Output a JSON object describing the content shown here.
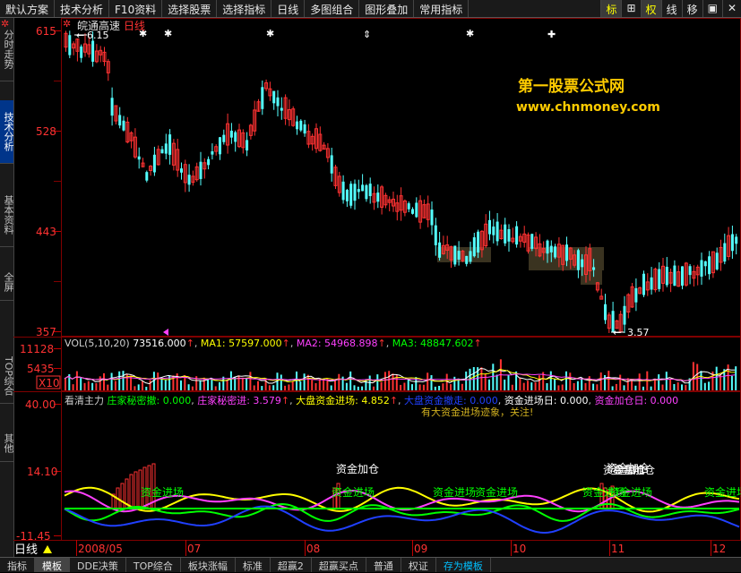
{
  "toolbar": {
    "items": [
      "默认方案",
      "技术分析",
      "F10资料",
      "选择股票",
      "选择指标",
      "日线",
      "多图组合",
      "图形叠加",
      "常用指标"
    ],
    "right_items": [
      "标",
      "权",
      "线",
      "移"
    ]
  },
  "leftnav": {
    "tabs": [
      "分时走势",
      "技术分析",
      "基本资料",
      "全屏",
      "TOP综合",
      "其他"
    ],
    "active": "技术分析"
  },
  "stock": {
    "name": "皖通高速",
    "period": "日线",
    "high_label": "6.15",
    "low_label": "3.57"
  },
  "watermark": {
    "line1": "第一股票公式网",
    "line2": "www.chnmoney.com"
  },
  "price_axis": [
    "615",
    "528",
    "443",
    "357"
  ],
  "volume": {
    "title": "VOL(5,10,20)",
    "value": "73516.000",
    "ma1": "MA1: 57597.000",
    "ma2": "MA2: 54968.898",
    "ma3": "MA3: 48847.602",
    "axis": [
      "11128",
      "5435",
      "X10"
    ]
  },
  "indicator": {
    "name": "看清主力",
    "items": [
      {
        "label": "庄家秘密撤: 0.000",
        "color": "#00ff00"
      },
      {
        "label": "庄家秘密进: 3.579",
        "color": "#ff40ff"
      },
      {
        "label": "大盘资金进场: 4.852",
        "color": "#ffff00"
      },
      {
        "label": "大盘资金撤走: 0.000",
        "color": "#0000ff"
      },
      {
        "label": "资金进场日: 0.000",
        "color": "#ffffff"
      },
      {
        "label": "资金加仓日: 0.000",
        "color": "#ff40ff"
      }
    ],
    "note": "有大资金进场迹象，关注!",
    "axis": [
      "40.00",
      "14.10",
      "-11.45"
    ],
    "annotations": [
      "资金进场",
      "资金加仓"
    ]
  },
  "time_axis": {
    "period": "日线",
    "labels": [
      "2008/05",
      "07",
      "08",
      "09",
      "10",
      "11",
      "12"
    ]
  },
  "bottom_tabs": {
    "items": [
      "指标",
      "模板",
      "DDE决策",
      "TOP综合",
      "板块涨幅",
      "标准",
      "超赢2",
      "超赢买点",
      "普通",
      "权证",
      "存为模板"
    ],
    "active": "模板",
    "highlight": "存为模板"
  },
  "colors": {
    "up": "#ff3232",
    "down": "#54ffff",
    "axis_red": "#c00000",
    "grid": "#800000"
  },
  "chart_data": {
    "type": "candlestick",
    "price_range": [
      3.57,
      6.15
    ],
    "annotated_high": 6.15,
    "annotated_low": 3.57,
    "volume_range": [
      0,
      11128
    ],
    "indicator_range": [
      -11.45,
      40.0
    ]
  }
}
